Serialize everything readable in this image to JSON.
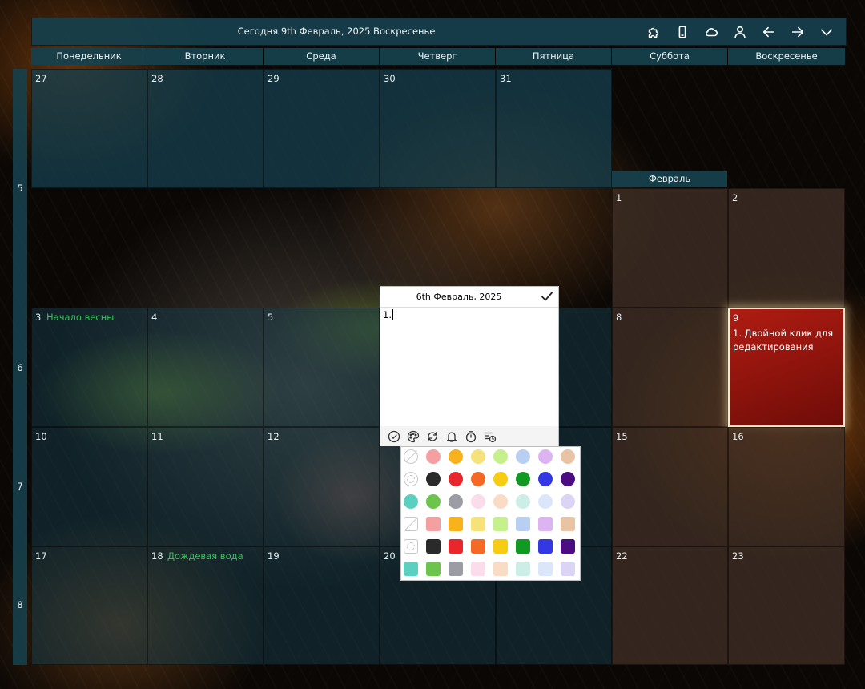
{
  "header": {
    "title": "Сегодня 9th Февраль, 2025 Воскресенье",
    "icons": [
      "puzzle-icon",
      "phone-icon",
      "cloud-icon",
      "user-icon",
      "arrow-left-icon",
      "arrow-right-icon",
      "chevron-down-icon"
    ]
  },
  "days": [
    "Понедельник",
    "Вторник",
    "Среда",
    "Четверг",
    "Пятница",
    "Суббота",
    "Воскресенье"
  ],
  "weeks": [
    "5",
    "6",
    "7",
    "8"
  ],
  "month_label": "Февраль",
  "cells": {
    "jan27": "27",
    "jan28": "28",
    "jan29": "29",
    "jan30": "30",
    "jan31": "31",
    "feb1": "1",
    "feb2": "2",
    "feb3": "3",
    "feb4": "4",
    "feb5": "5",
    "feb8": "8",
    "feb9": "9",
    "feb10": "10",
    "feb11": "11",
    "feb12": "12",
    "feb15": "15",
    "feb16": "16",
    "feb17": "17",
    "feb18": "18",
    "feb19": "19",
    "feb20": "20",
    "feb22": "22",
    "feb23": "23"
  },
  "events": {
    "feb3": "Начало весны",
    "feb18": "Дождевая вода",
    "feb9_note": "1. Двойной клик для редактирования"
  },
  "editor": {
    "title": "6th Февраль, 2025",
    "text": "1."
  },
  "toolbar_icons": [
    "check-circle-icon",
    "palette-icon",
    "repeat-icon",
    "bell-icon",
    "timer-icon",
    "list-clock-icon"
  ],
  "palette": {
    "round": [
      "none",
      "#f4a0a0",
      "#f7b21c",
      "#f6e27a",
      "#c6f08c",
      "#b8cff2",
      "#dcb4f2",
      "#e8c4a4",
      "wheel",
      "#2a2a2a",
      "#e8262c",
      "#f46a24",
      "#f8cc10",
      "#109a22",
      "#3438e4",
      "#4c0c84",
      "#5cd0c0",
      "#6cc44c",
      "#9c9ca4",
      "#fadcea",
      "#fadcc6",
      "#cceee6",
      "#dce6fa",
      "#dcd4f4"
    ],
    "square": [
      "none",
      "#f4a0a0",
      "#f7b21c",
      "#f6e27a",
      "#c6f08c",
      "#b8cff2",
      "#dcb4f2",
      "#e8c4a4",
      "wheel",
      "#2a2a2a",
      "#e8262c",
      "#f46a24",
      "#f8cc10",
      "#109a22",
      "#3438e4",
      "#4c0c84",
      "#5cd0c0",
      "#6cc44c",
      "#9c9ca4",
      "#fadcea",
      "#fadcc6",
      "#cceee6",
      "#dce6fa",
      "#dcd4f4"
    ]
  }
}
